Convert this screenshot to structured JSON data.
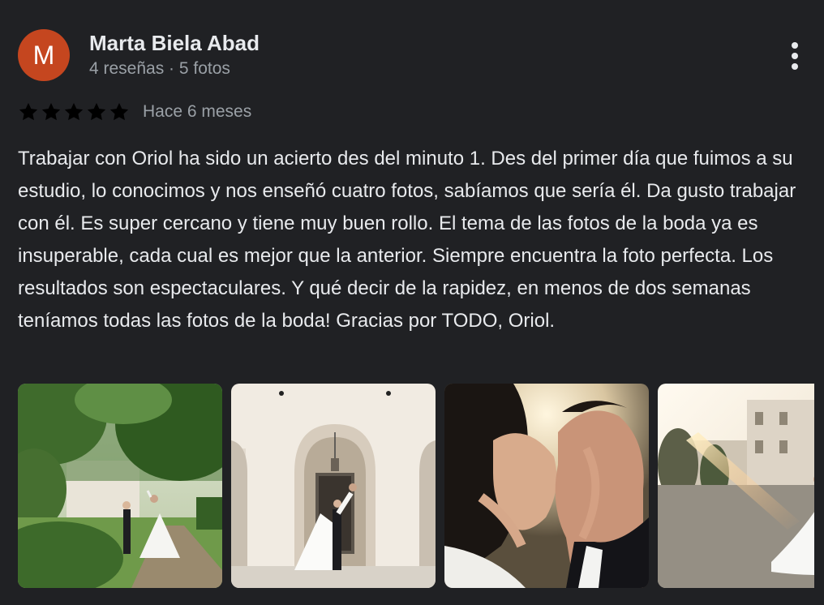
{
  "review": {
    "author": {
      "name": "Marta Biela Abad",
      "initial": "M",
      "meta": "4 reseñas · 5 fotos",
      "avatar_color": "#c5461f"
    },
    "rating": 5,
    "star_color": "#fbbc04",
    "date": "Hace 6 meses",
    "text": "Trabajar con Oriol ha sido un acierto des del minuto 1. Des del primer día que fuimos a su estudio, lo conocimos y nos enseñó cuatro fotos, sabíamos que sería él. Da gusto trabajar con él. Es super cercano y tiene muy buen rollo. El tema de las fotos de la boda ya es insuperable, cada cual es mejor que la anterior. Siempre encuentra la foto perfecta. Los resultados son espectaculares. Y qué decir de la rapidez, en menos de dos semanas teníamos todas las fotos de la boda! Gracias por TODO, Oriol."
  },
  "more_options_icon": "more-vertical-icon",
  "photos": [
    {
      "name": "photo-garden-couple"
    },
    {
      "name": "photo-arch-lift"
    },
    {
      "name": "photo-kiss-sunset"
    },
    {
      "name": "photo-courtyard-flare"
    }
  ],
  "theme": {
    "background": "#202124",
    "text_primary": "#e8eaed",
    "text_secondary": "#9aa0a6"
  }
}
